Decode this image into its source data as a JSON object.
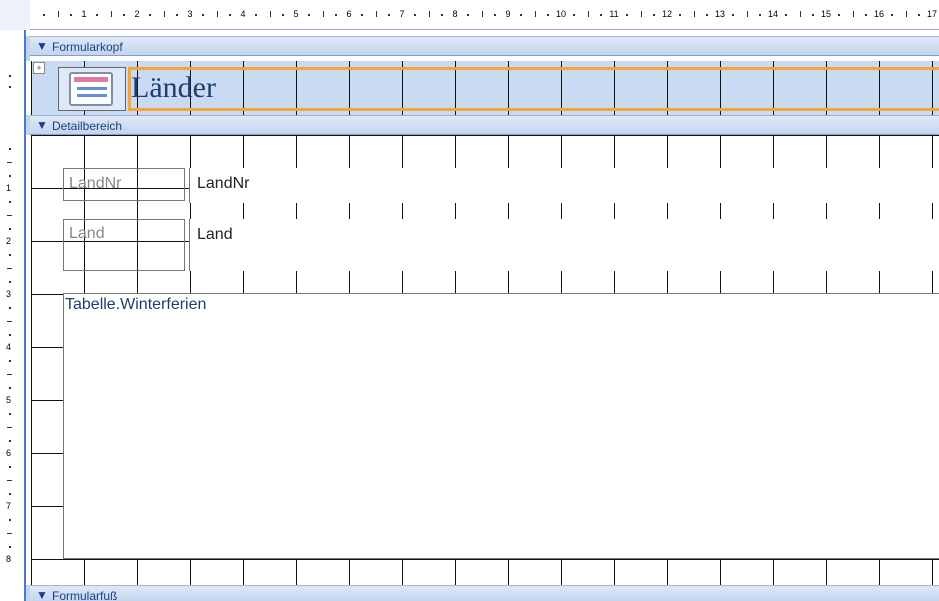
{
  "ruler": {
    "horizontal_numbers": [
      "1",
      "2",
      "3",
      "4",
      "5",
      "6",
      "7",
      "8",
      "9",
      "10",
      "11",
      "12",
      "13",
      "14",
      "15",
      "16",
      "17"
    ],
    "vertical_numbers": [
      "1",
      "2",
      "3",
      "4",
      "5",
      "6",
      "7",
      "8"
    ]
  },
  "sections": {
    "header": {
      "label": "Formularkopf",
      "icon": "collapse-arrow-icon"
    },
    "detail": {
      "label": "Detailbereich",
      "icon": "collapse-arrow-icon"
    },
    "footer": {
      "label": "Formularfuß",
      "icon": "collapse-arrow-icon"
    }
  },
  "form_header": {
    "title": "Länder",
    "logo_icon": "form-logo-icon",
    "move_handle_icon": "move-handle-icon",
    "title_border_color": "#f5a437"
  },
  "detail": {
    "controls": [
      {
        "label": "LandNr",
        "field": "LandNr"
      },
      {
        "label": "Land",
        "field": "Land"
      }
    ],
    "subform": {
      "label": "Tabelle.Winterferien"
    }
  },
  "colors": {
    "section_bar": "#c4d4ee",
    "section_text": "#15428b",
    "header_bg": "#c9daf3",
    "accent_blue": "#4a7bc8"
  }
}
